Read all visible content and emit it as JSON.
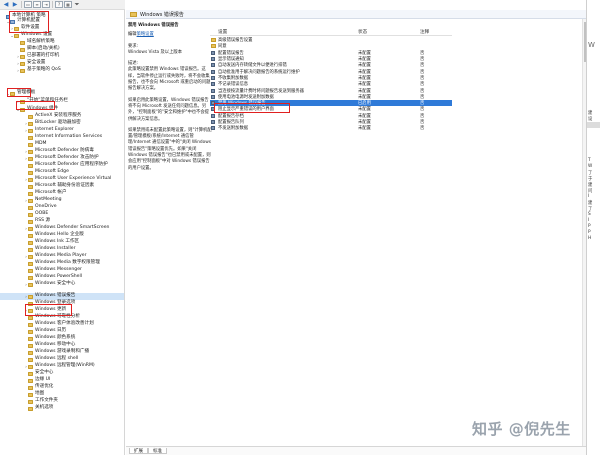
{
  "toolbar": {
    "buttons": [
      "back-icon",
      "forward-icon",
      "up-folder-icon",
      "properties-icon",
      "export-icon",
      "help-icon",
      "view-icon",
      "filter-icon"
    ]
  },
  "tree": {
    "items": [
      {
        "label": "本地计算机 策略",
        "chev": ""
      },
      {
        "label": "计算机配置",
        "chev": "⌄"
      },
      {
        "label": "软件设置",
        "chev": "›"
      },
      {
        "label": "Windows 设置",
        "chev": "⌄"
      },
      {
        "label": "域名解析策略",
        "chev": ""
      },
      {
        "label": "脚本(启动/关机)",
        "chev": ""
      },
      {
        "label": "已部署的打印机",
        "chev": "›"
      },
      {
        "label": "安全设置",
        "chev": "›"
      },
      {
        "label": "基于策略的 QoS",
        "chev": "›"
      },
      {
        "label": "管理模板",
        "chev": "⌄"
      },
      {
        "label": "\"开始\"菜单和任务栏",
        "chev": "›"
      },
      {
        "label": "Windows 组件",
        "chev": "⌄"
      },
      {
        "label": "ActiveX 安装程序服务",
        "chev": ""
      },
      {
        "label": "BitLocker 驱动器加密",
        "chev": "›"
      },
      {
        "label": "Internet Explorer",
        "chev": "›"
      },
      {
        "label": "Internet Information Services",
        "chev": ""
      },
      {
        "label": "MDM",
        "chev": ""
      },
      {
        "label": "Microsoft Defender 防病毒",
        "chev": "›"
      },
      {
        "label": "Microsoft Defender 攻击防护",
        "chev": "›"
      },
      {
        "label": "Microsoft Defender 应用程序防护",
        "chev": ""
      },
      {
        "label": "Microsoft Edge",
        "chev": ""
      },
      {
        "label": "Microsoft User Experience Virtual",
        "chev": "›"
      },
      {
        "label": "Microsoft 辅助身份验证因素",
        "chev": ""
      },
      {
        "label": "Microsoft 帐户",
        "chev": ""
      },
      {
        "label": "NetMeeting",
        "chev": "›"
      },
      {
        "label": "OneDrive",
        "chev": ""
      },
      {
        "label": "OOBE",
        "chev": ""
      },
      {
        "label": "RSS 源",
        "chev": ""
      },
      {
        "label": "Windows Defender SmartScreen",
        "chev": "›"
      },
      {
        "label": "Windows Hello 企业版",
        "chev": ""
      },
      {
        "label": "Windows Ink 工作区",
        "chev": ""
      },
      {
        "label": "Windows Installer",
        "chev": ""
      },
      {
        "label": "Windows Media Player",
        "chev": "›"
      },
      {
        "label": "Windows Media 数字权限管理",
        "chev": ""
      },
      {
        "label": "Windows Messenger",
        "chev": ""
      },
      {
        "label": "Windows PowerShell",
        "chev": ""
      },
      {
        "label": "Windows 安全中心",
        "chev": "›"
      },
      {
        "label": "Windows 错误报告",
        "chev": "›"
      },
      {
        "label": "Windows 登录选项",
        "chev": ""
      },
      {
        "label": "Windows 更新",
        "chev": "›"
      },
      {
        "label": "Windows 可靠性分析",
        "chev": ""
      },
      {
        "label": "Windows 客户体验改善计划",
        "chev": ""
      },
      {
        "label": "Windows 日历",
        "chev": ""
      },
      {
        "label": "Windows 颜色系统",
        "chev": ""
      },
      {
        "label": "Windows 移动中心",
        "chev": ""
      },
      {
        "label": "Windows 游戏录制和广播",
        "chev": ""
      },
      {
        "label": "Windows 远程 shell",
        "chev": ""
      },
      {
        "label": "Windows 远程管理(WinRM)",
        "chev": "›"
      },
      {
        "label": "安全中心",
        "chev": ""
      },
      {
        "label": "边缘 UI",
        "chev": ""
      },
      {
        "label": "传递优化",
        "chev": ""
      },
      {
        "label": "地图",
        "chev": ""
      },
      {
        "label": "工作文件夹",
        "chev": ""
      },
      {
        "label": "关机选项",
        "chev": ""
      }
    ]
  },
  "main": {
    "header_title": "Windows 错误报告",
    "desc": {
      "title": "禁用 Windows 错误报告",
      "edit_prefix": "编辑",
      "edit_link": "策略设置",
      "req_label": "要求:",
      "req_value": "Windows Vista 及以上版本",
      "desc_label": "描述:",
      "desc_p1": "此策略设置禁用 Windows 错误报告。这样，当软件停止运行或失败时，将不会收集报告，也不会向 Microsoft 或重启动的问题报告解决方案。",
      "desc_p2": "如果启用此策略设置，Windows 错误报告将不向 Microsoft 发送任何问题信息。另外，\"控制面板\"的\"安全和维护\"中也不会提供解决方案信息。",
      "desc_p3": "如果禁用或未配置此策略设置，则\"计算机配置/管理模板/系统/Internet 通信管理/Internet 通信设置\"中的\"关闭 Windows 错误报告\"策略设置优先。如果\"关闭 Windows 错误报告\"也已禁用或未配置，则会应用\"控制面板\"中对 Windows 错误报告的用户设置。"
    },
    "columns": {
      "setting": "设置",
      "state": "状态",
      "comment": "注释"
    },
    "rows": [
      {
        "name": "高级错误报告设置",
        "state": "",
        "comment": "",
        "folder": true
      },
      {
        "name": "同意",
        "state": "",
        "comment": "",
        "folder": true
      },
      {
        "name": "配置错误报告",
        "state": "未配置",
        "comment": "否",
        "folder": false
      },
      {
        "name": "显示错误通知",
        "state": "未配置",
        "comment": "否",
        "folder": false
      },
      {
        "name": "自动发送内存转储文件以便进行排错",
        "state": "未配置",
        "comment": "否",
        "folder": false
      },
      {
        "name": "自动批准用于解决问题报告的系统运行维护",
        "state": "未配置",
        "comment": "否",
        "folder": false
      },
      {
        "name": "不收集附加数据",
        "state": "未配置",
        "comment": "否",
        "folder": false
      },
      {
        "name": "不记录错误信息",
        "state": "未配置",
        "comment": "否",
        "folder": false
      },
      {
        "name": "当连接按流量计费时将问题报告发送到服务器",
        "state": "未配置",
        "comment": "否",
        "folder": false
      },
      {
        "name": "使用电池电源时发送附加数据",
        "state": "未配置",
        "comment": "否",
        "folder": false
      },
      {
        "name": "禁用 Windows 错误报告",
        "state": "已启用",
        "comment": "否",
        "folder": false,
        "selected": true
      },
      {
        "name": "阻止显示严重错误的用户界面",
        "state": "未配置",
        "comment": "否",
        "folder": false
      },
      {
        "name": "配置报告存档",
        "state": "未配置",
        "comment": "否",
        "folder": false
      },
      {
        "name": "配置报告队列",
        "state": "未配置",
        "comment": "否",
        "folder": false
      },
      {
        "name": "不发送附加数据",
        "state": "未配置",
        "comment": "否",
        "folder": false
      }
    ],
    "tabs": [
      "扩展",
      "标准"
    ]
  },
  "right_panel": {
    "big_text": "W",
    "lines": [
      "建",
      "设",
      "T",
      "W",
      "了",
      "于",
      "建",
      "问",
      "I",
      "建",
      "了",
      "S",
      "I",
      "P",
      "P",
      "H"
    ]
  },
  "watermark": "知乎 @倪先生"
}
